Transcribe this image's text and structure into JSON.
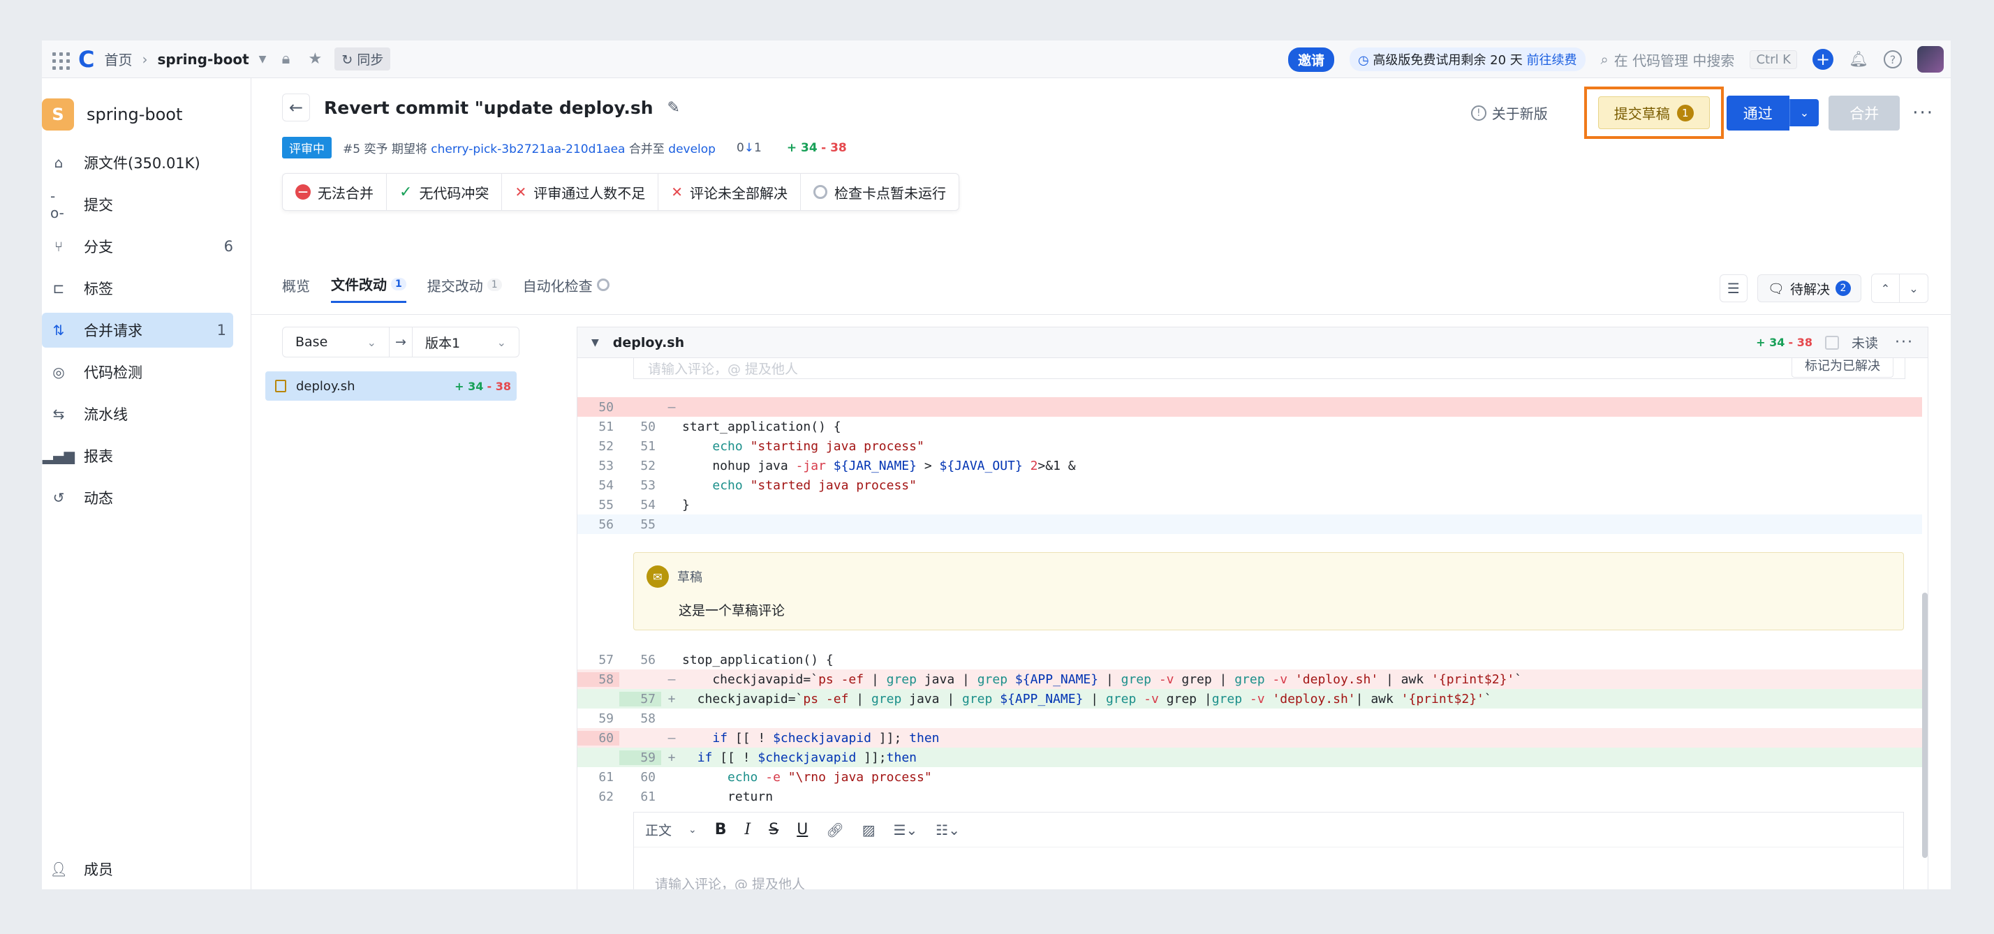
{
  "topbar": {
    "home": "首页",
    "repo": "spring-boot",
    "sync": "同步",
    "invite": "邀请",
    "trial_text": "高级版免费试用剩余 20 天",
    "trial_link": "前往续费",
    "search_placeholder": "在 代码管理 中搜索",
    "shortcut": "Ctrl K"
  },
  "sidebar": {
    "repo_initial": "S",
    "repo_name": "spring-boot",
    "items": [
      {
        "label": "源文件(350.01K)",
        "icon": "file-icon",
        "count": ""
      },
      {
        "label": "提交",
        "icon": "commit-icon",
        "count": ""
      },
      {
        "label": "分支",
        "icon": "branch-icon",
        "count": "6"
      },
      {
        "label": "标签",
        "icon": "tag-icon",
        "count": ""
      },
      {
        "label": "合并请求",
        "icon": "merge-request-icon",
        "count": "1"
      },
      {
        "label": "代码检测",
        "icon": "scan-icon",
        "count": ""
      },
      {
        "label": "流水线",
        "icon": "pipeline-icon",
        "count": ""
      },
      {
        "label": "报表",
        "icon": "chart-icon",
        "count": ""
      },
      {
        "label": "动态",
        "icon": "history-icon",
        "count": ""
      }
    ],
    "bottom": "成员"
  },
  "mr": {
    "title": "Revert commit \"update deploy.sh",
    "status": "评审中",
    "id_author": "#5 奕予 期望将",
    "source_branch": "cherry-pick-3b2721aa-210d1aea",
    "merge_to": "合并至",
    "target_branch": "develop",
    "behind": "0",
    "ahead": "1",
    "additions": "+ 34",
    "deletions": "- 38",
    "checks": [
      {
        "label": "无法合并",
        "type": "error"
      },
      {
        "label": "无代码冲突",
        "type": "ok"
      },
      {
        "label": "评审通过人数不足",
        "type": "fail"
      },
      {
        "label": "评论未全部解决",
        "type": "fail"
      },
      {
        "label": "检查卡点暂未运行",
        "type": "pending"
      }
    ]
  },
  "actions": {
    "about": "关于新版",
    "draft": "提交草稿",
    "draft_count": "1",
    "approve": "通过",
    "merge": "合并"
  },
  "tabs": [
    {
      "label": "概览",
      "count": ""
    },
    {
      "label": "文件改动",
      "count": "1"
    },
    {
      "label": "提交改动",
      "count": "1"
    },
    {
      "label": "自动化检查",
      "count": ""
    }
  ],
  "pending": {
    "label": "待解决",
    "count": "2"
  },
  "compare": {
    "base": "Base",
    "version": "版本1"
  },
  "file": {
    "name": "deploy.sh",
    "additions": "+ 34",
    "deletions": "- 38"
  },
  "diff": {
    "file": "deploy.sh",
    "additions": "+ 34",
    "deletions": "- 38",
    "unread": "未读",
    "comment_placeholder": "请输入评论，@ 提及他人",
    "resolve": "标记为已解决",
    "draft_label": "草稿",
    "draft_text": "这是一个草稿评论",
    "editor_format": "正文",
    "editor_placeholder": "请输入评论，@ 提及他人"
  }
}
